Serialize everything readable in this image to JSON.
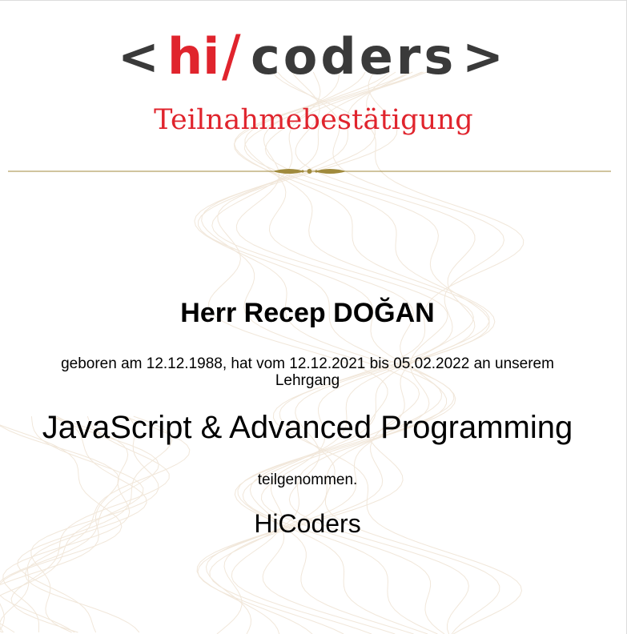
{
  "certificate": {
    "logo": {
      "open": "<",
      "hi": "hi",
      "slash": "/",
      "coders": "coders",
      "close": ">"
    },
    "heading": "Teilnahmebestätigung",
    "name": "Herr Recep DOĞAN",
    "intro_line1": "geboren am 12.12.1988, hat vom 12.12.2021 bis 05.02.2022 an unserem",
    "intro_line2": "Lehrgang",
    "course": "JavaScript & Advanced Programming",
    "participated": "teilgenommen.",
    "organization": "HiCoders"
  },
  "colors": {
    "brand_red": "#e0242d",
    "brand_dark": "#3a3a3a",
    "divider_gold": "#a08a3c",
    "watermark": "#f1e7da"
  }
}
